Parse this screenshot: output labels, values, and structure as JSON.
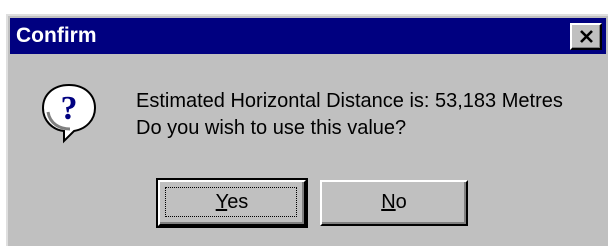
{
  "dialog": {
    "title": "Confirm",
    "message_line1": "Estimated Horizontal Distance is: 53,183 Metres",
    "message_line2": "Do you wish to use this value?",
    "icon": "question-icon",
    "close_icon": "close-icon",
    "buttons": {
      "yes_accel": "Y",
      "yes_rest": "es",
      "no_accel": "N",
      "no_rest": "o"
    },
    "colors": {
      "titlebar": "#000080",
      "face": "#c0c0c0"
    }
  }
}
